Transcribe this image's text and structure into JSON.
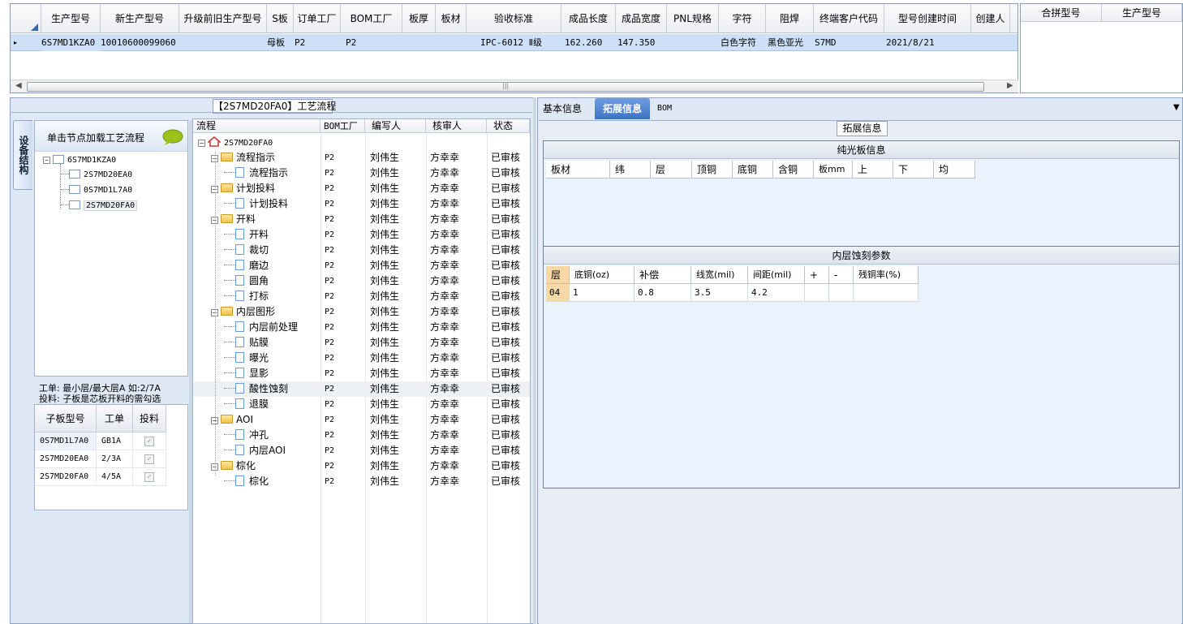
{
  "top_grid": {
    "headers": [
      "生产型号",
      "新生产型号",
      "升级前旧生产型号",
      "S板",
      "订单工厂",
      "BOM工厂",
      "板厚",
      "板材",
      "验收标准",
      "成品长度",
      "成品宽度",
      "PNL规格",
      "字符",
      "阻焊",
      "终端客户代码",
      "型号创建时间",
      "创建人"
    ],
    "row": {
      "生产型号": "6S7MD1KZA0",
      "新生产型号": "10010600099060",
      "升级前旧生产型号": "",
      "S板": "母板",
      "订单工厂": "P2",
      "BOM工厂": "P2",
      "板厚": "",
      "板材": "",
      "验收标准": "IPC-6012 Ⅱ级",
      "成品长度": "162.260",
      "成品宽度": "147.350",
      "PNL规格": "",
      "字符": "白色字符",
      "阻焊": "黑色亚光",
      "终端客户代码": "S7MD",
      "型号创建时间": "2021/8/21",
      "创建人": ""
    },
    "scroll_grip": "|||"
  },
  "merge_grid": {
    "headers": [
      "合拼型号",
      "生产型号"
    ]
  },
  "left": {
    "vertical_tab": "设备结构",
    "tree_hint": "单击节点加载工艺流程",
    "tree": [
      "6S7MD1KZA0",
      "2S7MD20EA0",
      "0S7MD1L7A0",
      "2S7MD20FA0"
    ],
    "note_line1": "工单: 最小层/最大层A 如:2/7A",
    "note_line2": "投料: 子板是芯板开料的需勾选",
    "sub_headers": [
      "子板型号",
      "工单",
      "投料"
    ],
    "sub_rows": [
      {
        "model": "0S7MD1L7A0",
        "order": "GB1A"
      },
      {
        "model": "2S7MD20EA0",
        "order": "2/3A"
      },
      {
        "model": "2S7MD20FA0",
        "order": "4/5A"
      }
    ]
  },
  "flow": {
    "title": "【2S7MD20FA0】工艺流程",
    "headers": [
      "流程",
      "BOM工厂",
      "编写人",
      "核审人",
      "状态"
    ],
    "root": "2S7MD20FA0",
    "rows": [
      {
        "name": "流程指示",
        "folder": true,
        "bom": "P2",
        "writer": "刘伟生",
        "checker": "方幸幸",
        "status": "已审核"
      },
      {
        "name": "流程指示",
        "folder": false,
        "bom": "P2",
        "writer": "刘伟生",
        "checker": "方幸幸",
        "status": "已审核"
      },
      {
        "name": "计划投料",
        "folder": true,
        "bom": "P2",
        "writer": "刘伟生",
        "checker": "方幸幸",
        "status": "已审核"
      },
      {
        "name": "计划投料",
        "folder": false,
        "bom": "P2",
        "writer": "刘伟生",
        "checker": "方幸幸",
        "status": "已审核"
      },
      {
        "name": "开料",
        "folder": true,
        "bom": "P2",
        "writer": "刘伟生",
        "checker": "方幸幸",
        "status": "已审核"
      },
      {
        "name": "开料",
        "folder": false,
        "bom": "P2",
        "writer": "刘伟生",
        "checker": "方幸幸",
        "status": "已审核"
      },
      {
        "name": "裁切",
        "folder": false,
        "bom": "P2",
        "writer": "刘伟生",
        "checker": "方幸幸",
        "status": "已审核"
      },
      {
        "name": "磨边",
        "folder": false,
        "bom": "P2",
        "writer": "刘伟生",
        "checker": "方幸幸",
        "status": "已审核"
      },
      {
        "name": "圆角",
        "folder": false,
        "bom": "P2",
        "writer": "刘伟生",
        "checker": "方幸幸",
        "status": "已审核"
      },
      {
        "name": "打标",
        "folder": false,
        "bom": "P2",
        "writer": "刘伟生",
        "checker": "方幸幸",
        "status": "已审核"
      },
      {
        "name": "内层图形",
        "folder": true,
        "bom": "P2",
        "writer": "刘伟生",
        "checker": "方幸幸",
        "status": "已审核"
      },
      {
        "name": "内层前处理",
        "folder": false,
        "bom": "P2",
        "writer": "刘伟生",
        "checker": "方幸幸",
        "status": "已审核"
      },
      {
        "name": "贴膜",
        "folder": false,
        "bom": "P2",
        "writer": "刘伟生",
        "checker": "方幸幸",
        "status": "已审核"
      },
      {
        "name": "曝光",
        "folder": false,
        "bom": "P2",
        "writer": "刘伟生",
        "checker": "方幸幸",
        "status": "已审核"
      },
      {
        "name": "显影",
        "folder": false,
        "bom": "P2",
        "writer": "刘伟生",
        "checker": "方幸幸",
        "status": "已审核"
      },
      {
        "name": "酸性蚀刻",
        "folder": false,
        "bom": "P2",
        "writer": "刘伟生",
        "checker": "方幸幸",
        "status": "已审核"
      },
      {
        "name": "退膜",
        "folder": false,
        "bom": "P2",
        "writer": "刘伟生",
        "checker": "方幸幸",
        "status": "已审核"
      },
      {
        "name": "AOI",
        "folder": true,
        "bom": "P2",
        "writer": "刘伟生",
        "checker": "方幸幸",
        "status": "已审核"
      },
      {
        "name": "冲孔",
        "folder": false,
        "bom": "P2",
        "writer": "刘伟生",
        "checker": "方幸幸",
        "status": "已审核"
      },
      {
        "name": "内层AOI",
        "folder": false,
        "bom": "P2",
        "writer": "刘伟生",
        "checker": "方幸幸",
        "status": "已审核"
      },
      {
        "name": "棕化",
        "folder": true,
        "bom": "P2",
        "writer": "刘伟生",
        "checker": "方幸幸",
        "status": "已审核"
      },
      {
        "name": "棕化",
        "folder": false,
        "bom": "P2",
        "writer": "刘伟生",
        "checker": "方幸幸",
        "status": "已审核"
      }
    ]
  },
  "right": {
    "tabs": [
      "基本信息",
      "拓展信息",
      "BOM"
    ],
    "group_title": "拓展信息",
    "section1": "纯光板信息",
    "section1_headers": [
      "板材",
      "纬",
      "层",
      "顶铜",
      "底铜",
      "含铜",
      "板mm",
      "上",
      "下",
      "均"
    ],
    "section2": "内层蚀刻参数",
    "section2_headers": [
      "层",
      "底铜(oz)",
      "补偿",
      "线宽(mil)",
      "间距(mil)",
      "+",
      "-",
      "残铜率(%)"
    ],
    "section2_row": [
      "04",
      "1",
      "0.8",
      "3.5",
      "4.2",
      "",
      "",
      ""
    ]
  },
  "colors": {
    "selected_row": "#cde0f7",
    "active_tab": "#3d72c5",
    "panel_bg": "#dfe8f5",
    "layer_cell": "#f7d9a8"
  }
}
